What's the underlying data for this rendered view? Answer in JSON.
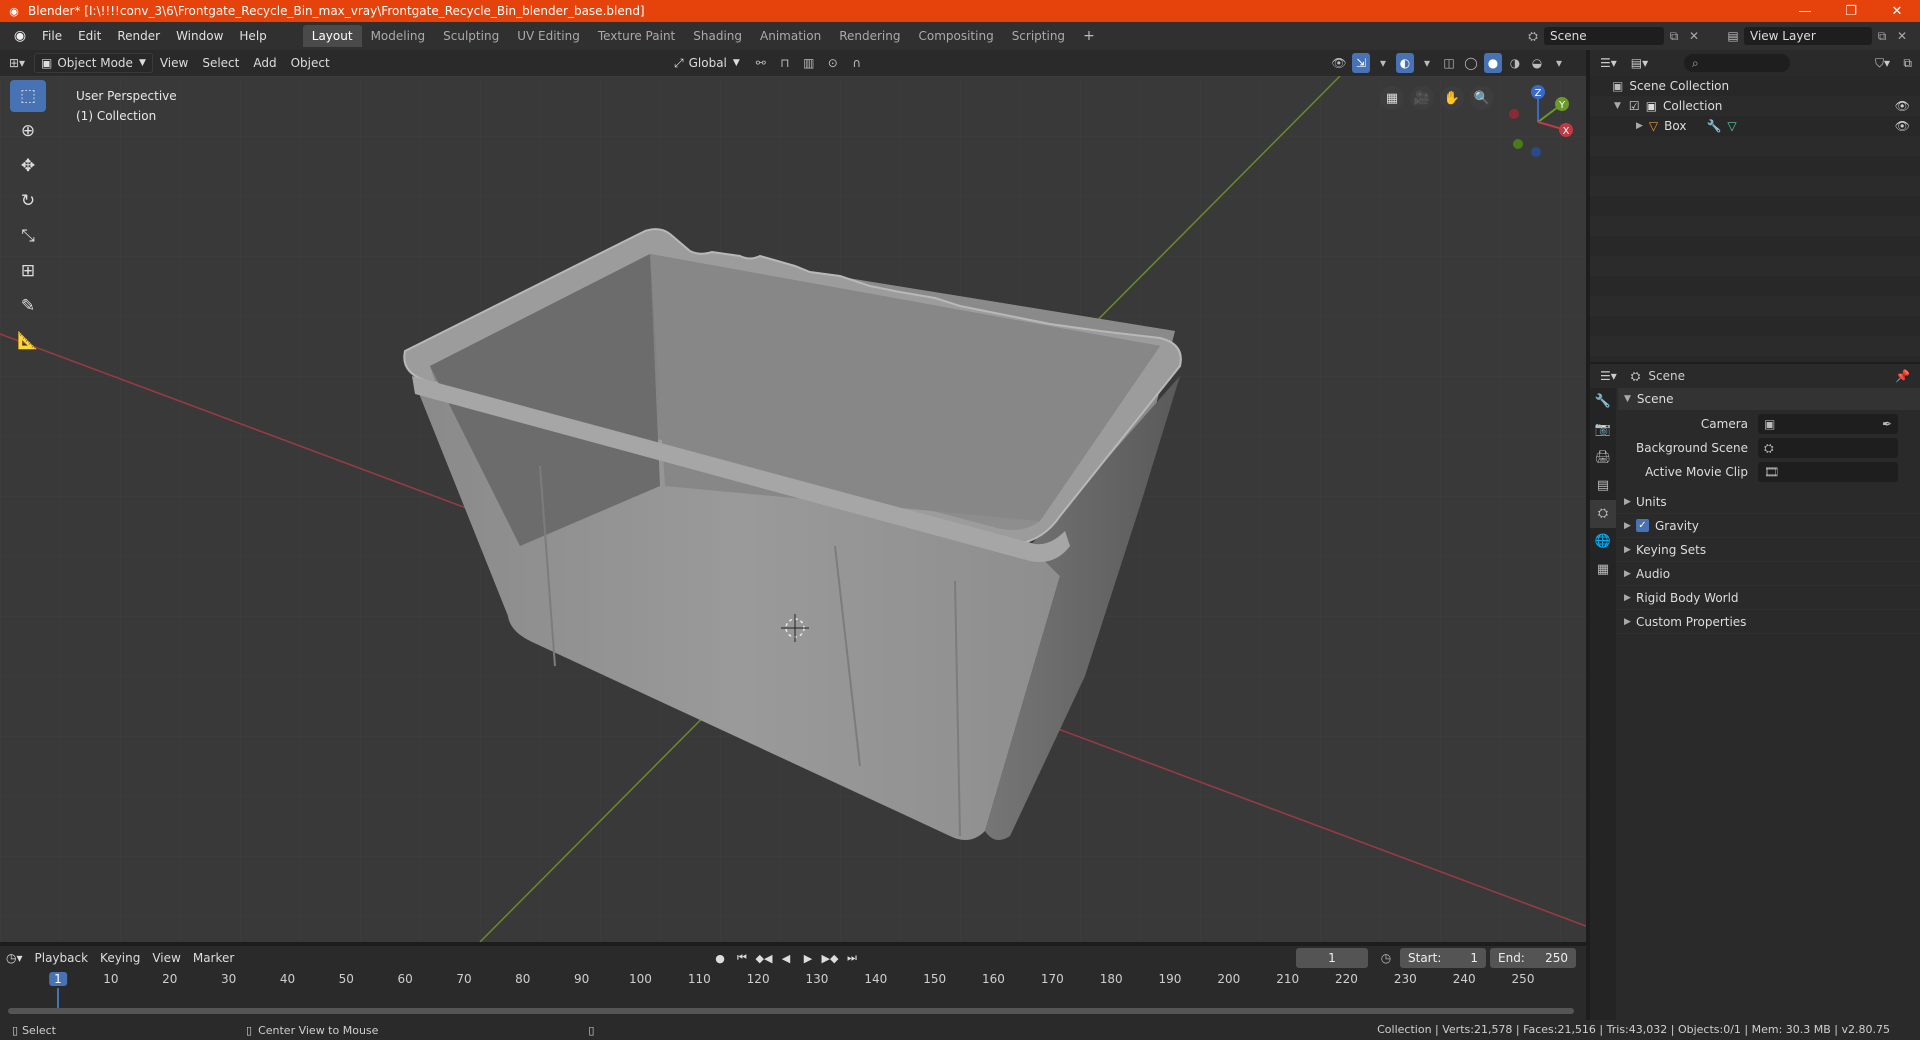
{
  "window": {
    "title": "Blender* [I:\\!!!!conv_3\\6\\Frontgate_Recycle_Bin_max_vray\\Frontgate_Recycle_Bin_blender_base.blend]",
    "minimize": "—",
    "maximize": "❐",
    "close": "✕"
  },
  "menu": [
    "File",
    "Edit",
    "Render",
    "Window",
    "Help"
  ],
  "workspaces": [
    "Layout",
    "Modeling",
    "Sculpting",
    "UV Editing",
    "Texture Paint",
    "Shading",
    "Animation",
    "Rendering",
    "Compositing",
    "Scripting"
  ],
  "active_workspace": "Layout",
  "scene_selector": "Scene",
  "view_layer": "View Layer",
  "viewport": {
    "mode": "Object Mode",
    "menus": [
      "View",
      "Select",
      "Add",
      "Object"
    ],
    "orientation": "Global",
    "perspective_label": "User Perspective",
    "collection_label": "(1) Collection",
    "gizmo_axes": [
      "Z",
      "Y",
      "X"
    ]
  },
  "outliner": {
    "root": "Scene Collection",
    "collection": "Collection",
    "object": "Box"
  },
  "properties": {
    "context": "Scene",
    "section": "Scene",
    "camera_label": "Camera",
    "background_label": "Background Scene",
    "movieclip_label": "Active Movie Clip",
    "subpanels": [
      "Units",
      "Gravity",
      "Keying Sets",
      "Audio",
      "Rigid Body World",
      "Custom Properties"
    ]
  },
  "timeline": {
    "menus": [
      "Playback",
      "Keying",
      "View",
      "Marker"
    ],
    "current_frame": "1",
    "start_label": "Start:",
    "start": "1",
    "end_label": "End:",
    "end": "250",
    "ticks": [
      "1",
      "10",
      "20",
      "30",
      "40",
      "50",
      "60",
      "70",
      "80",
      "90",
      "100",
      "110",
      "120",
      "130",
      "140",
      "150",
      "160",
      "170",
      "180",
      "190",
      "200",
      "210",
      "220",
      "230",
      "240",
      "250"
    ]
  },
  "statusbar": {
    "left": "Select",
    "middle": "Center View to Mouse",
    "right": "Collection | Verts:21,578 | Faces:21,516 | Tris:43,032 | Objects:0/1 | Mem: 30.3 MB | v2.80.75"
  },
  "colors": {
    "title_bar": "#e5430b",
    "accent": "#4772b3",
    "viewport_bg": "#393939"
  }
}
